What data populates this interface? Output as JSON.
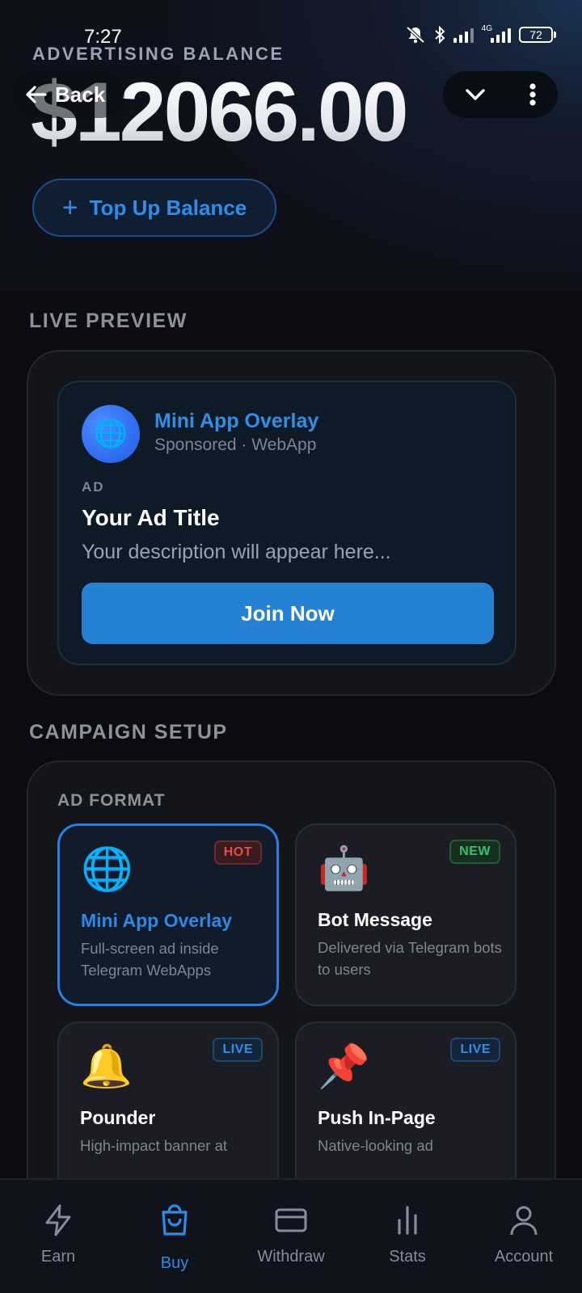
{
  "status_bar": {
    "time": "7:27",
    "network": "4G",
    "battery": "72"
  },
  "header": {
    "balance_label": "ADVERTISING BALANCE",
    "balance_amount": "$12066.00",
    "back_label": "Back",
    "topup_label": "Top Up Balance"
  },
  "live_preview": {
    "section_title": "LIVE PREVIEW",
    "app_name": "Mini App Overlay",
    "sponsor_line": "Sponsored · WebApp",
    "ad_tag": "AD",
    "ad_title": "Your Ad Title",
    "ad_description": "Your description will appear here...",
    "cta_label": "Join Now"
  },
  "campaign_setup": {
    "section_title": "CAMPAIGN SETUP",
    "ad_format_label": "AD FORMAT",
    "formats": [
      {
        "title": "Mini App Overlay",
        "description": "Full-screen ad inside Telegram WebApps",
        "badge": "HOT",
        "icon": "globe-icon",
        "selected": true
      },
      {
        "title": "Bot Message",
        "description": "Delivered via Telegram bots to users",
        "badge": "NEW",
        "icon": "robot-icon",
        "selected": false
      },
      {
        "title": "Pounder",
        "description": "High-impact banner at",
        "badge": "LIVE",
        "icon": "bell-icon",
        "selected": false
      },
      {
        "title": "Push In-Page",
        "description": "Native-looking ad",
        "badge": "LIVE",
        "icon": "pushpin-icon",
        "selected": false
      }
    ]
  },
  "bottom_nav": {
    "items": [
      {
        "label": "Earn",
        "icon": "lightning-icon"
      },
      {
        "label": "Buy",
        "icon": "shopping-bag-icon",
        "active": true
      },
      {
        "label": "Withdraw",
        "icon": "credit-card-icon"
      },
      {
        "label": "Stats",
        "icon": "bar-chart-icon"
      },
      {
        "label": "Account",
        "icon": "user-icon"
      }
    ]
  },
  "colors": {
    "accent": "#2581d4",
    "hot": "#e24c4c",
    "new": "#37c269",
    "live": "#2e8fe6",
    "background": "#0b0b11"
  }
}
